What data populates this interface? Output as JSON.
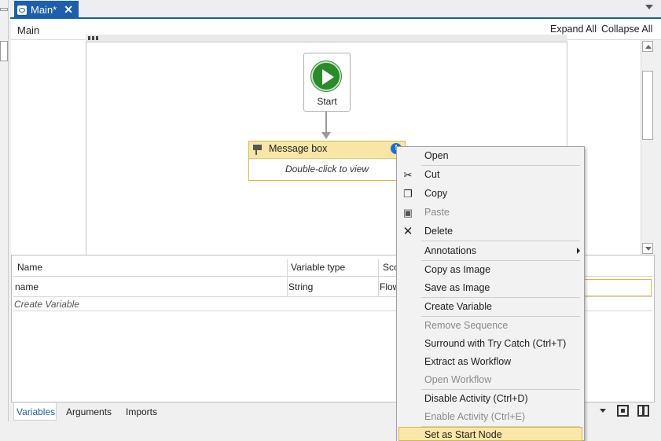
{
  "tab": {
    "title": "Main*",
    "close_glyph": "✕"
  },
  "header": {
    "breadcrumb": "Main",
    "expand_all": "Expand All",
    "collapse_all": "Collapse All"
  },
  "flowchart": {
    "start_label": "Start",
    "message_box": {
      "title": "Message box",
      "hint": "Double-click to view",
      "info_glyph": "!"
    }
  },
  "variables": {
    "columns": [
      "Name",
      "Variable type",
      "Sco"
    ],
    "rows": [
      {
        "name": "name",
        "type": "String",
        "scope": "Flow"
      }
    ],
    "create_label": "Create Variable"
  },
  "bottom_tabs": [
    "Variables",
    "Arguments",
    "Imports"
  ],
  "context_menu": {
    "items": [
      {
        "label": "Open",
        "icon": "none",
        "enabled": true
      },
      {
        "label": "Cut",
        "icon": "scissors-icon",
        "enabled": true
      },
      {
        "label": "Copy",
        "icon": "copy-icon",
        "enabled": true
      },
      {
        "label": "Paste",
        "icon": "paste-icon",
        "enabled": false
      },
      {
        "label": "Delete",
        "icon": "delete-x-icon",
        "enabled": true
      },
      {
        "label": "Annotations",
        "icon": "none",
        "enabled": true,
        "submenu": true
      },
      {
        "label": "Copy as Image",
        "icon": "none",
        "enabled": true
      },
      {
        "label": "Save as Image",
        "icon": "none",
        "enabled": true
      },
      {
        "label": "Create Variable",
        "icon": "none",
        "enabled": true
      },
      {
        "label": "Remove Sequence",
        "icon": "none",
        "enabled": false
      },
      {
        "label": "Surround with Try Catch (Ctrl+T)",
        "icon": "none",
        "enabled": true
      },
      {
        "label": "Extract as Workflow",
        "icon": "none",
        "enabled": true
      },
      {
        "label": "Open Workflow",
        "icon": "none",
        "enabled": false
      },
      {
        "label": "Disable Activity (Ctrl+D)",
        "icon": "none",
        "enabled": true
      },
      {
        "label": "Enable Activity (Ctrl+E)",
        "icon": "none",
        "enabled": false
      },
      {
        "label": "Set as Start Node",
        "icon": "none",
        "enabled": true,
        "highlighted": true
      }
    ]
  },
  "colors": {
    "accent": "#1b5fad",
    "start_green": "#2b8b2b",
    "activity_header": "#f7e6a6",
    "menu_highlight": "#fbe8a8"
  }
}
